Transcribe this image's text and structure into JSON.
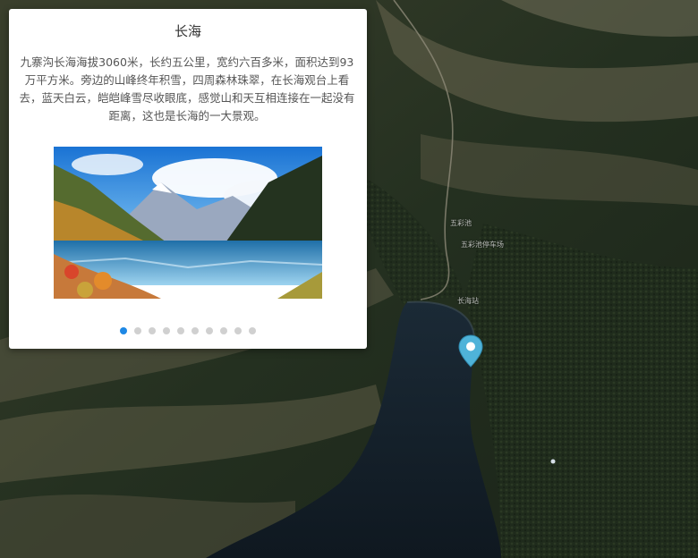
{
  "map": {
    "labels": [
      "五彩池",
      "五彩池停车场",
      "长海站"
    ],
    "marker": {
      "icon": "map-pin-icon",
      "color": "#4fb3d9"
    }
  },
  "popup": {
    "title": "长海",
    "description": "九寨沟长海海拔3060米，长约五公里，宽约六百多米，面积达到93万平方米。旁边的山峰终年积雪，四周森林珠翠，在长海观台上看去，蓝天白云，皑皑峰雪尽收眼底，感觉山和天互相连接在一起没有距离，这也是长海的一大景观。",
    "photo_alt": "长海",
    "carousel": {
      "count": 10,
      "active": 0,
      "active_color": "#1e88e5",
      "inactive_color": "#d0d0d0"
    }
  }
}
